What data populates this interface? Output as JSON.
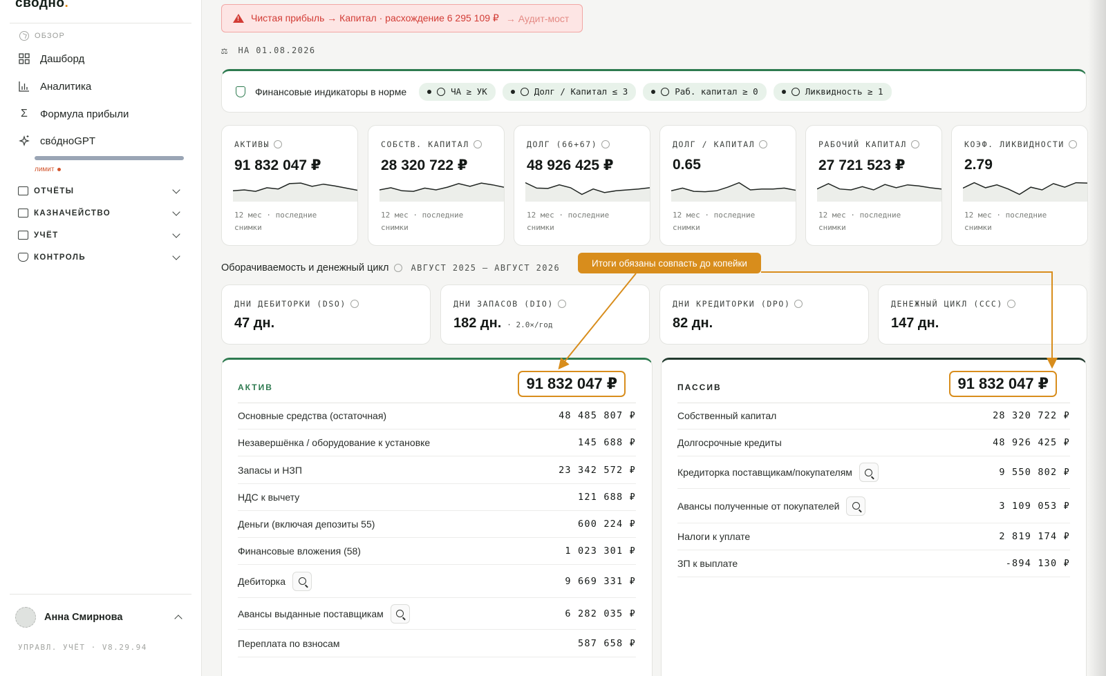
{
  "sidebar": {
    "logo": "сводно",
    "logo_dot": ".",
    "section_title": "ОБЗОР",
    "nav": [
      {
        "label": "Дашборд",
        "icon": "dashboard-grid-icon"
      },
      {
        "label": "Аналитика",
        "icon": "bar-chart-icon"
      },
      {
        "label": "Формула прибыли",
        "icon": "sigma-icon"
      },
      {
        "label": "свóдноGPT",
        "icon": "sparkle-icon"
      }
    ],
    "limit_label": "лимит",
    "groups": [
      {
        "label": "ОТЧЁТЫ",
        "icon": "reports-icon"
      },
      {
        "label": "КАЗНАЧЕЙСТВО",
        "icon": "bank-icon"
      },
      {
        "label": "УЧЁТ",
        "icon": "book-icon"
      },
      {
        "label": "КОНТРОЛЬ",
        "icon": "shield-check-icon"
      }
    ],
    "user_name": "Анна Смирнова",
    "version": "УПРАВЛ. УЧЁТ · V8.29.94"
  },
  "alert": {
    "text": "Чистая прибыль → Капитал · расхождение 6 295 109 ₽",
    "link": "→ Аудит-мост"
  },
  "as_of": "НА 01.08.2026",
  "status": {
    "title": "Финансовые индикаторы в норме",
    "pills": [
      "ЧА ≥ УК",
      "Долг / Капитал ≤ 3",
      "Раб. капитал ≥ 0",
      "Ликвидность ≥ 1"
    ]
  },
  "kpis": [
    {
      "label": "АКТИВЫ",
      "value": "91 832 047 ₽",
      "note": "12 мес · последние снимки",
      "spark": [
        0.45,
        0.5,
        0.42,
        0.62,
        0.55,
        0.85,
        0.88,
        0.7,
        0.82,
        0.72,
        0.6,
        0.48
      ]
    },
    {
      "label": "СОБСТВ. КАПИТАЛ",
      "value": "28 320 722 ₽",
      "note": "12 мес · последние снимки",
      "spark": [
        0.5,
        0.62,
        0.45,
        0.42,
        0.6,
        0.5,
        0.65,
        0.85,
        0.7,
        0.88,
        0.78,
        0.65
      ]
    },
    {
      "label": "ДОЛГ (66+67)",
      "value": "48 926 425 ₽",
      "note": "12 мес · последние снимки",
      "spark": [
        0.9,
        0.6,
        0.58,
        0.78,
        0.62,
        0.25,
        0.55,
        0.35,
        0.45,
        0.5,
        0.55,
        0.62
      ]
    },
    {
      "label": "ДОЛГ / КАПИТАЛ",
      "value": "0.65",
      "note": "12 мес · последние снимки",
      "spark": [
        0.45,
        0.6,
        0.42,
        0.4,
        0.45,
        0.65,
        0.9,
        0.5,
        0.55,
        0.55,
        0.6,
        0.48
      ]
    },
    {
      "label": "РАБОЧИЙ КАПИТАЛ",
      "value": "27 721 523 ₽",
      "note": "12 мес · последние снимки",
      "spark": [
        0.55,
        0.85,
        0.55,
        0.5,
        0.68,
        0.5,
        0.8,
        0.62,
        0.78,
        0.72,
        0.62,
        0.55
      ]
    },
    {
      "label": "КОЭФ. ЛИКВИДНОСТИ",
      "value": "2.79",
      "note": "12 мес · последние снимки",
      "spark": [
        0.6,
        0.9,
        0.62,
        0.78,
        0.55,
        0.25,
        0.65,
        0.5,
        0.85,
        0.65,
        0.9,
        0.88
      ]
    }
  ],
  "turnover": {
    "title": "Оборачиваемость и денежный цикл",
    "period": "АВГУСТ 2025 – АВГУСТ 2026",
    "cards": [
      {
        "label": "ДНИ ДЕБИТОРКИ (DSO)",
        "value": "47 дн.",
        "extra": ""
      },
      {
        "label": "ДНИ ЗАПАСОВ (DIO)",
        "value": "182 дн.",
        "extra": "· 2.0×/год"
      },
      {
        "label": "ДНИ КРЕДИТОРКИ (DPO)",
        "value": "82 дн.",
        "extra": ""
      },
      {
        "label": "ДЕНЕЖНЫЙ ЦИКЛ (CCC)",
        "value": "147 дн.",
        "extra": ""
      }
    ]
  },
  "callout": "Итоги обязаны совпасть до копейки",
  "assets": {
    "title": "АКТИВ",
    "total": "91 832 047 ₽",
    "rows": [
      {
        "label": "Основные средства (остаточная)",
        "value": "48 485 807 ₽",
        "lens": false
      },
      {
        "label": "Незавершёнка / оборудование к установке",
        "value": "145 688 ₽",
        "lens": false
      },
      {
        "label": "Запасы и НЗП",
        "value": "23 342 572 ₽",
        "lens": false
      },
      {
        "label": "НДС к вычету",
        "value": "121 688 ₽",
        "lens": false
      },
      {
        "label": "Деньги (включая депозиты 55)",
        "value": "600 224 ₽",
        "lens": false
      },
      {
        "label": "Финансовые вложения (58)",
        "value": "1 023 301 ₽",
        "lens": false
      },
      {
        "label": "Дебиторка",
        "value": "9 669 331 ₽",
        "lens": true
      },
      {
        "label": "Авансы выданные поставщикам",
        "value": "6 282 035 ₽",
        "lens": true
      },
      {
        "label": "Переплата по взносам",
        "value": "587 658 ₽",
        "lens": false
      }
    ]
  },
  "liabilities": {
    "title": "ПАССИВ",
    "total": "91 832 047 ₽",
    "rows": [
      {
        "label": "Собственный капитал",
        "value": "28 320 722 ₽",
        "lens": false
      },
      {
        "label": "Долгосрочные кредиты",
        "value": "48 926 425 ₽",
        "lens": false
      },
      {
        "label": "Кредиторка поставщикам/покупателям",
        "value": "9 550 802 ₽",
        "lens": true
      },
      {
        "label": "Авансы полученные от покупателей",
        "value": "3 109 053 ₽",
        "lens": true
      },
      {
        "label": "Налоги к уплате",
        "value": "2 819 174 ₽",
        "lens": false
      },
      {
        "label": "ЗП к выплате",
        "value": "-894 130 ₽",
        "lens": false
      }
    ]
  }
}
